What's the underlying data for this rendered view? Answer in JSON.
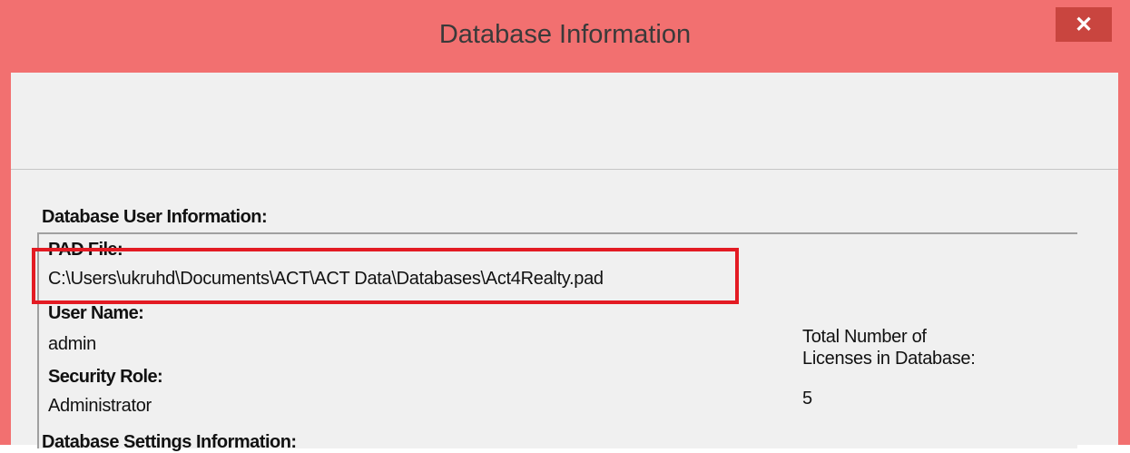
{
  "window": {
    "title": "Database Information",
    "close_label": "✕"
  },
  "user_info": {
    "heading": "Database User Information:",
    "pad_file_label": "PAD File:",
    "pad_file_value": "C:\\Users\\ukruhd\\Documents\\ACT\\ACT Data\\Databases\\Act4Realty.pad",
    "user_name_label": "User Name:",
    "user_name_value": "admin",
    "security_role_label": "Security Role:",
    "security_role_value": "Administrator",
    "licenses_label_line1": "Total Number of",
    "licenses_label_line2": "Licenses in Database:",
    "licenses_value": "5"
  },
  "next_section": {
    "heading": "Database Settings Information:"
  },
  "colors": {
    "titlebar": "#f27070",
    "close_button": "#c9453f",
    "highlight_box": "#e31b23",
    "client": "#f0f0f0"
  }
}
